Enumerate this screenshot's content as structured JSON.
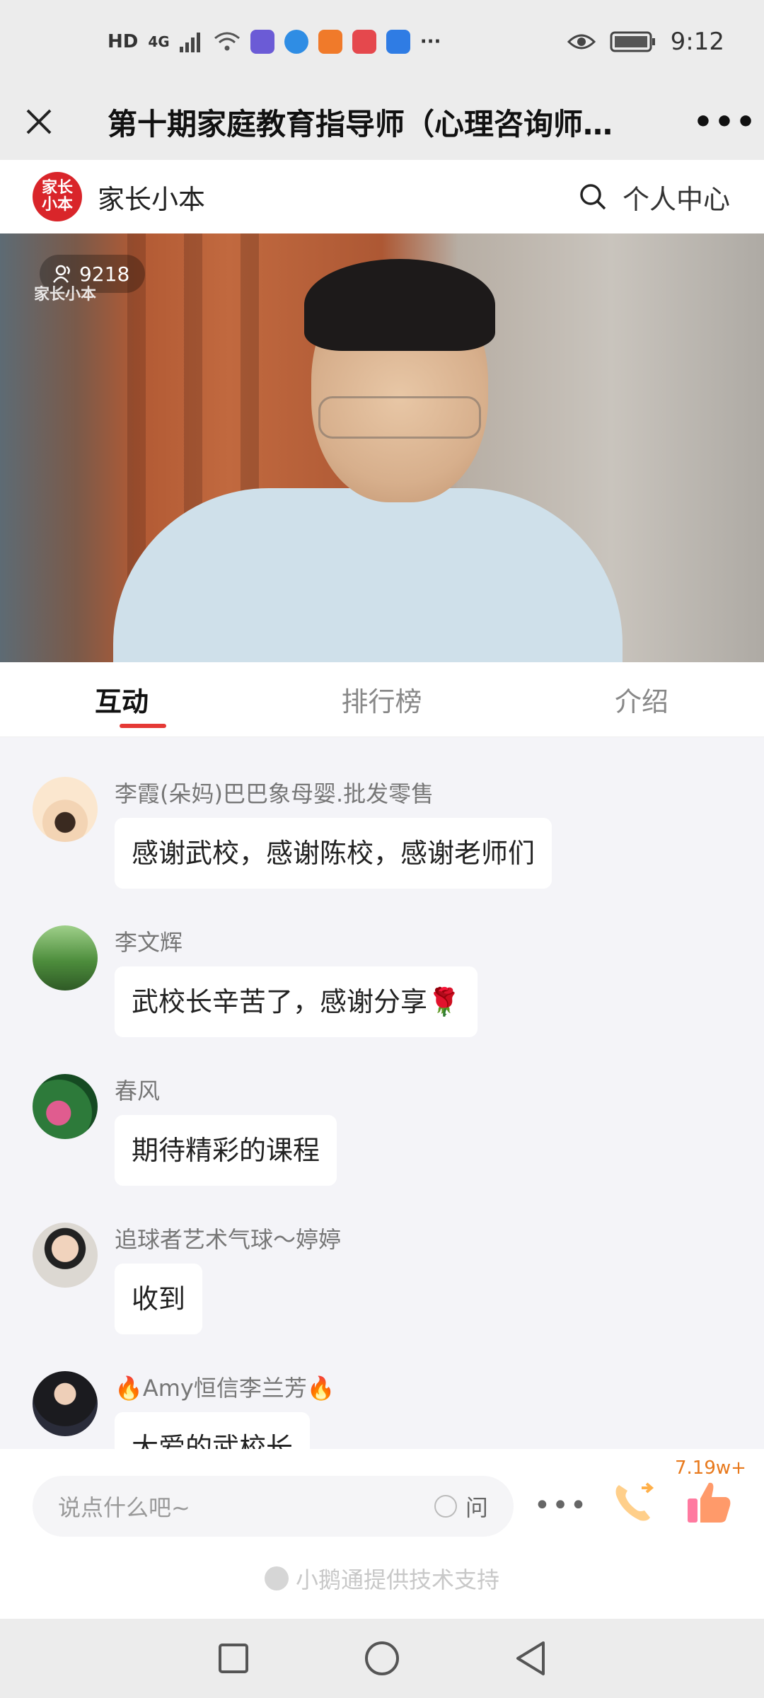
{
  "status_bar": {
    "left_text": "HD",
    "network": "4G",
    "more": "···",
    "time": "9:12"
  },
  "title_bar": {
    "title": "第十期家庭教育指导师（心理咨询师…",
    "more": "•••"
  },
  "brand": {
    "logo_text": "家长小本",
    "name": "家长小本",
    "profile_label": "个人中心"
  },
  "video": {
    "viewer_count": "9218",
    "watermark": "家长小本"
  },
  "tabs": [
    {
      "label": "互动",
      "active": true
    },
    {
      "label": "排行榜",
      "active": false
    },
    {
      "label": "介绍",
      "active": false
    }
  ],
  "messages": [
    {
      "name": "李霞(朵妈)巴巴象母婴.批发零售",
      "text": "感谢武校，感谢陈校，感谢老师们"
    },
    {
      "name": "李文辉",
      "text": "武校长辛苦了，感谢分享🌹"
    },
    {
      "name": "春风",
      "text": "期待精彩的课程"
    },
    {
      "name": "追球者艺术气球～婷婷",
      "text": "收到"
    },
    {
      "name": "Amy恒信李兰芳",
      "name_prefix": "🔥",
      "name_suffix": "🔥",
      "text": "大爱的武校长"
    }
  ],
  "input": {
    "placeholder": "说点什么吧~",
    "ask_label": "问",
    "more": "•••",
    "like_count": "7.19w+"
  },
  "powered_by": "小鹅通提供技术支持",
  "colors": {
    "accent": "#e53935",
    "like": "#e8791c",
    "brand": "#d9252a"
  }
}
